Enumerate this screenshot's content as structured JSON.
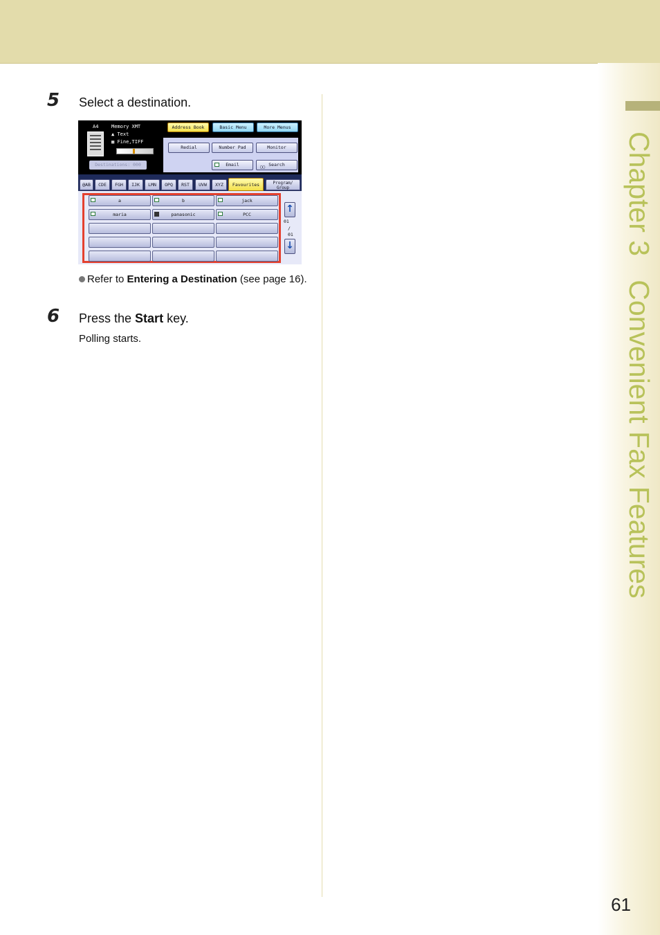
{
  "header": {
    "band_color": "#e3dcab"
  },
  "sidebar": {
    "chapter_label": "Chapter 3",
    "chapter_title": "Convenient Fax Features",
    "accent_color": "#b8c25a"
  },
  "steps": [
    {
      "number": "5",
      "text": "Select a destination."
    },
    {
      "number": "6",
      "text_before": "Press the ",
      "text_bold": "Start",
      "text_after": " key."
    }
  ],
  "note": {
    "prefix": "Refer to ",
    "bold": "Entering a Destination",
    "suffix": " (see page 16)."
  },
  "step6_result": "Polling starts.",
  "page_number": "61",
  "screen": {
    "status": {
      "paper": "A4",
      "mode": "Memory XMT",
      "original": "Text",
      "resolution": "Fine,TIFF",
      "destinations": "Destinations: 000"
    },
    "top_buttons": [
      "Address Book",
      "Basic Menu",
      "More Menus"
    ],
    "mid_buttons": [
      "Redial",
      "Number Pad",
      "Monitor"
    ],
    "low_buttons": [
      "Email",
      "Search"
    ],
    "tabs": [
      "@AB",
      "CDE",
      "FGH",
      "IJK",
      "LMN",
      "OPQ",
      "RST",
      "UVW",
      "XYZ",
      "Favourites"
    ],
    "tab_program_line1": "Program/",
    "tab_program_line2": "Group",
    "entries": [
      "a",
      "b",
      "jack",
      "maria",
      "panasonic",
      "PCC"
    ],
    "page_current": "01",
    "page_sep": "/",
    "page_total": "01",
    "colors": {
      "selected_tab": "#f4e14a",
      "highlight_box": "#e4402e"
    }
  }
}
